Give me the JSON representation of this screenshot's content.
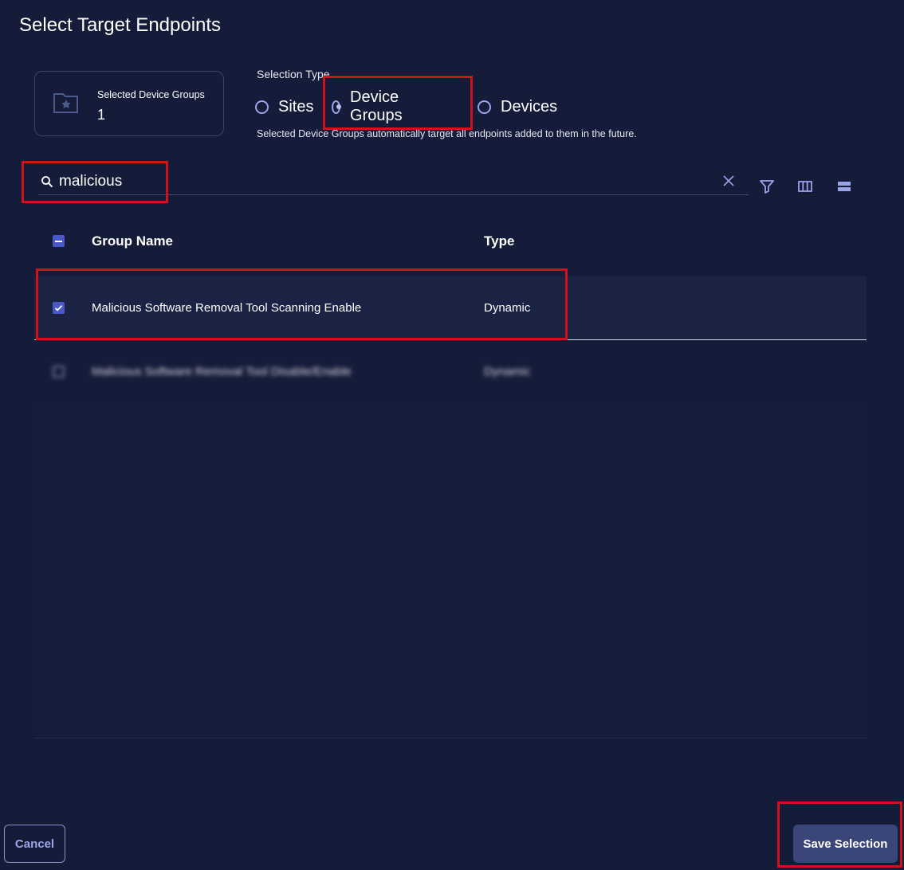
{
  "dialog": {
    "title": "Select Target Endpoints"
  },
  "summary": {
    "label": "Selected Device Groups",
    "count": "1"
  },
  "selection_type": {
    "label": "Selection Type",
    "options": [
      {
        "label": "Sites",
        "checked": false
      },
      {
        "label": "Device Groups",
        "checked": true
      },
      {
        "label": "Devices",
        "checked": false
      }
    ],
    "helper": "Selected Device Groups automatically target all endpoints added to them in the future."
  },
  "search": {
    "value": "malicious"
  },
  "table": {
    "columns": [
      "Group Name",
      "Type"
    ],
    "rows": [
      {
        "name": "Malicious Software Removal Tool Scanning Enable",
        "type": "Dynamic",
        "checked": true
      },
      {
        "name": "Malicious Software Removal Tool Disable/Enable",
        "type": "Dynamic",
        "checked": false,
        "blurred": true
      }
    ]
  },
  "footer": {
    "cancel_label": "Cancel",
    "save_label": "Save Selection"
  },
  "colors": {
    "background": "#151c39",
    "accent": "#4a57c7",
    "highlight": "#d0121b"
  }
}
